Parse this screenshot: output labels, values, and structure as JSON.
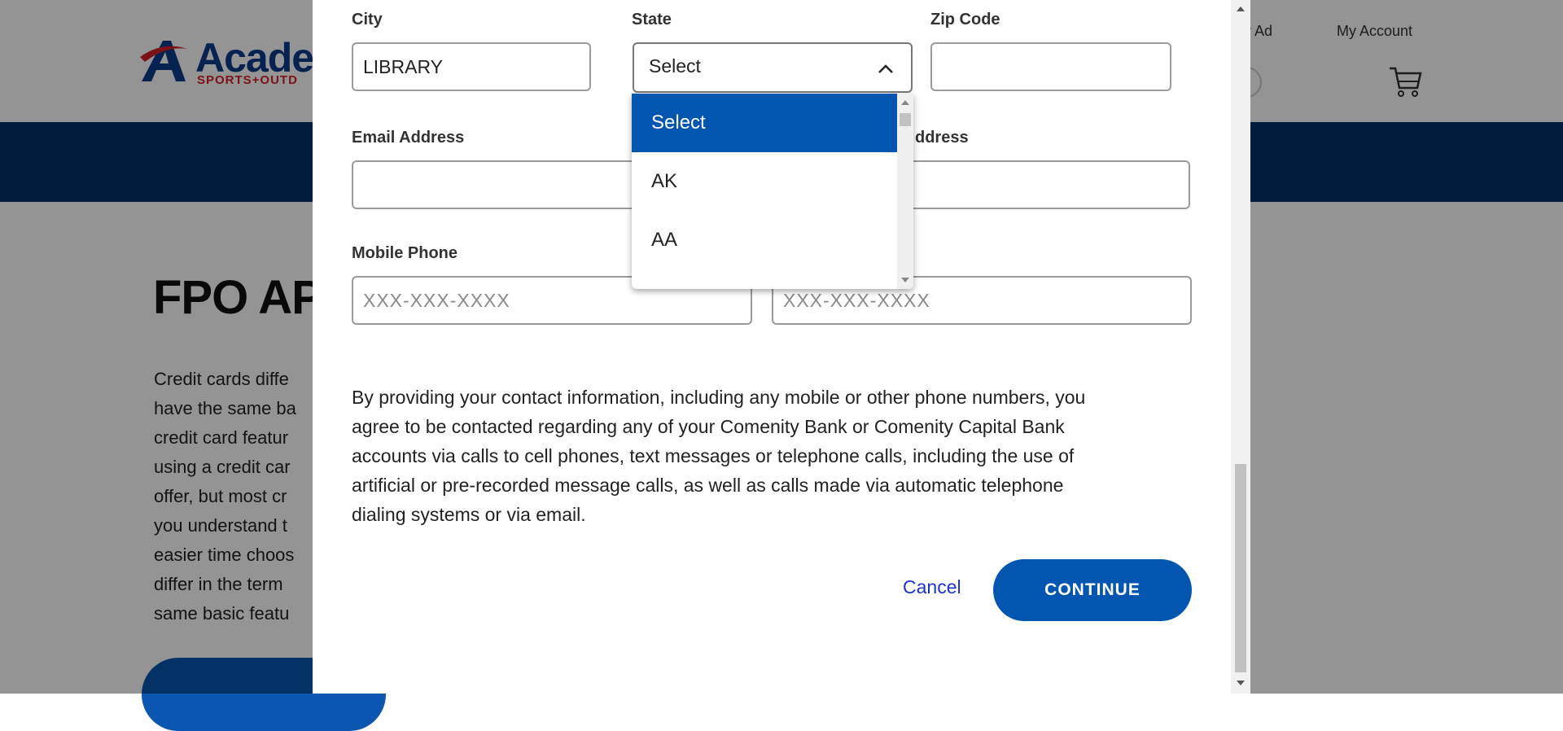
{
  "background": {
    "logo": {
      "word": "Acade",
      "tagline": "SPORTS+OUTD"
    },
    "header_links": [
      "ly Ad",
      "My Account"
    ],
    "page_title": "FPO APP",
    "paragraph_lines": [
      "Credit cards diffe",
      "have the same ba",
      "credit card featur",
      "using a credit car",
      "offer, but most cr",
      "you understand t",
      "easier time choos",
      "differ in the term",
      "same basic featu"
    ],
    "colors": {
      "navbar": "#012f66",
      "cta": "#0a56b0"
    }
  },
  "form": {
    "city": {
      "label": "City",
      "value": "LIBRARY"
    },
    "state": {
      "label": "State",
      "selected": "Select",
      "options": [
        "Select",
        "AK",
        "AA"
      ]
    },
    "zip": {
      "label": "Zip Code",
      "value": ""
    },
    "email": {
      "label": "Email Address",
      "value": ""
    },
    "email_confirm": {
      "label_visible": "ddress",
      "value": ""
    },
    "mobile_phone": {
      "label": "Mobile Phone",
      "placeholder": "XXX-XXX-XXXX"
    },
    "other_phone": {
      "placeholder": "XXX-XXX-XXXX"
    }
  },
  "consent_lines": [
    "By providing your contact information, including any mobile or other phone numbers, you",
    "agree to be contacted regarding any of your Comenity Bank or Comenity Capital Bank",
    "accounts via calls to cell phones, text messages or telephone calls, including the use of",
    "artificial or pre-recorded message calls, as well as calls made via automatic telephone",
    "dialing systems or via email."
  ],
  "actions": {
    "cancel_label": "Cancel",
    "continue_label": "CONTINUE"
  },
  "colors": {
    "primary": "#0356b0",
    "link": "#1a33d6",
    "overlay": "rgba(0,0,0,0.42)"
  }
}
